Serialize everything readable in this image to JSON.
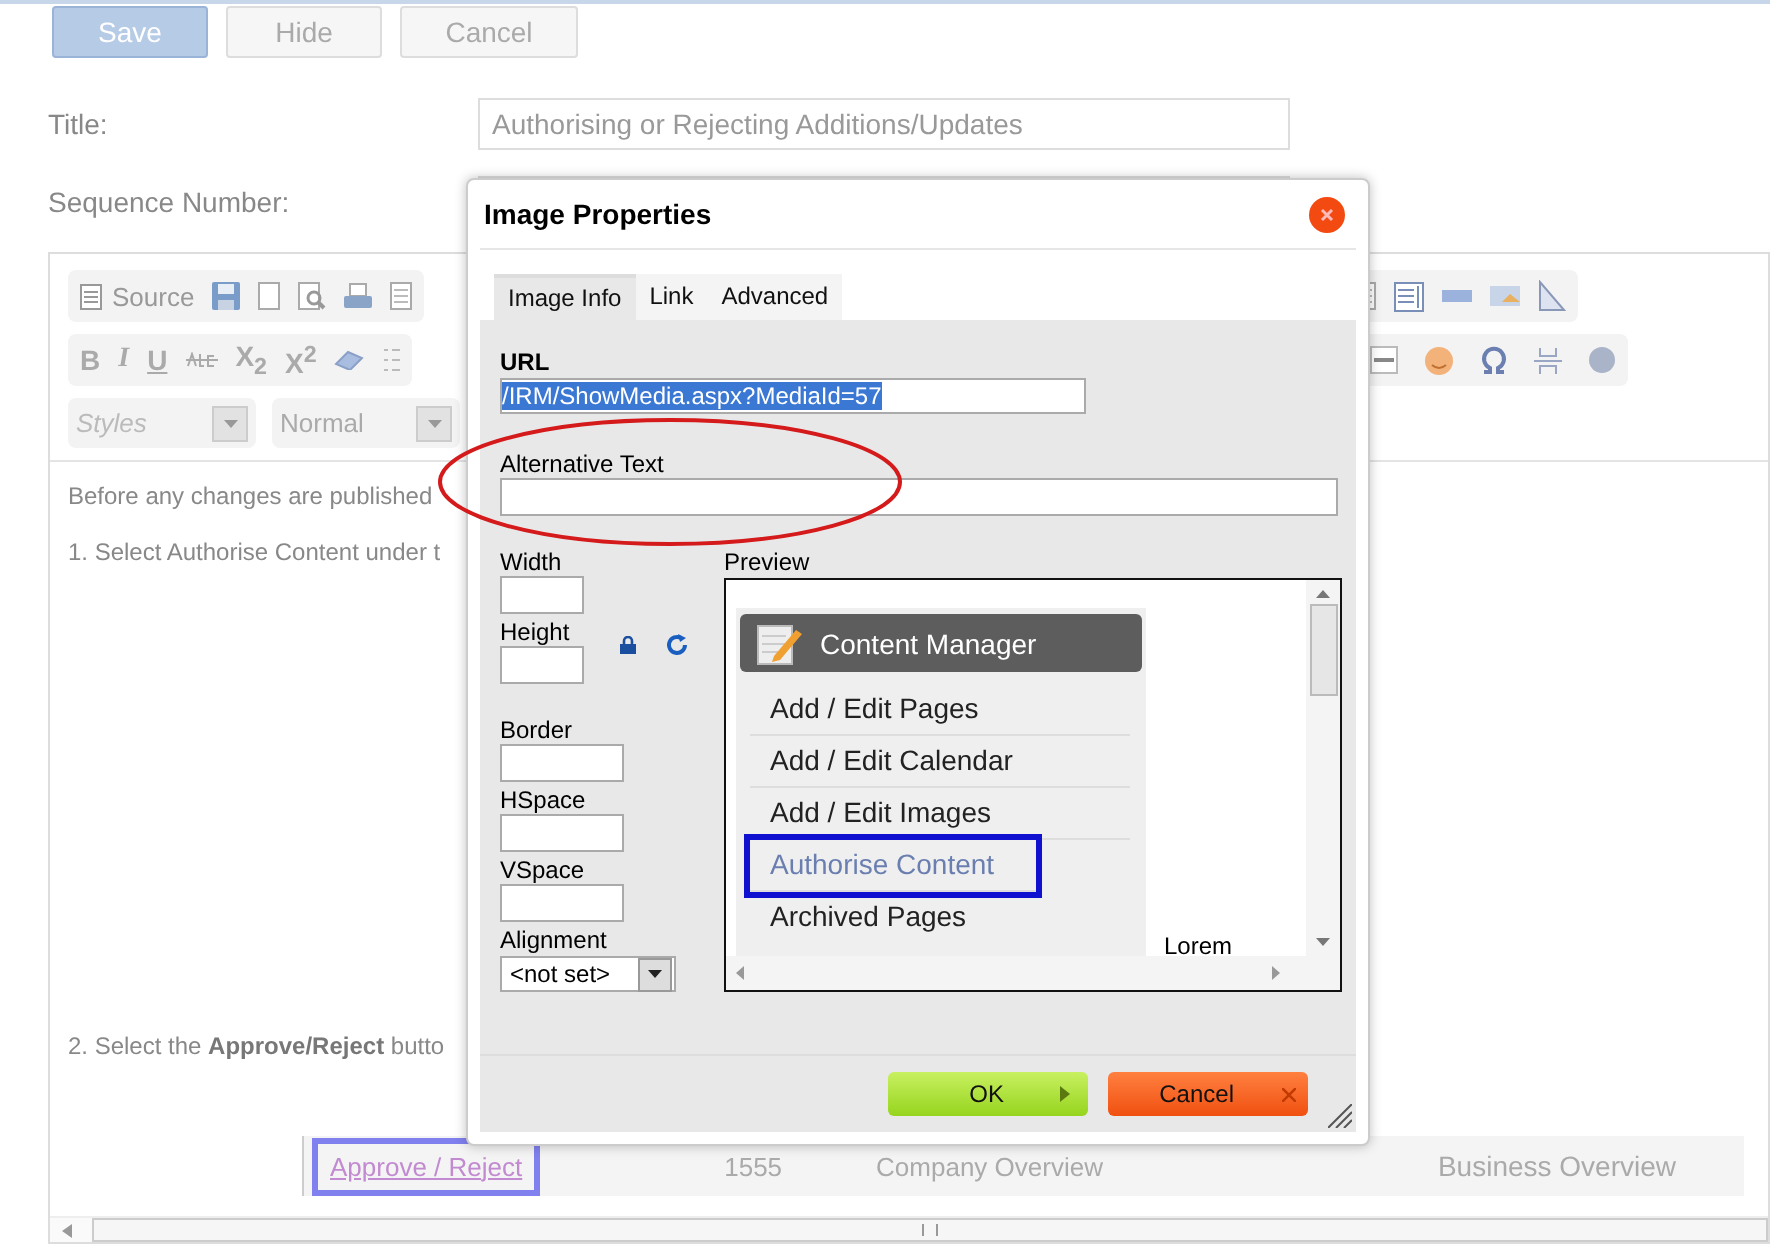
{
  "actions": [
    {
      "label": "Save",
      "kind": "primary"
    },
    {
      "label": "Hide",
      "kind": "plain"
    },
    {
      "label": "Cancel",
      "kind": "plain"
    }
  ],
  "form": [
    {
      "label": "Title:",
      "value": "Authorising or Rejecting Additions/Updates"
    },
    {
      "label": "Sequence Number:"
    }
  ],
  "editor": {
    "source_label": "Source",
    "format_buttons": [
      "B",
      "I",
      "U"
    ],
    "script_buttons": [
      "X$_{2}$",
      "X$^{2}$"
    ],
    "styles_placeholder": "Styles",
    "format_value": "Normal",
    "paragraphs": [
      "Before any changes are published",
      "1. Select Authorise Content under t"
    ],
    "step_two": "2. Select the **Approve/Reject** butto",
    "row": {
      "link": "Approve / Reject",
      "cells": [
        "1555",
        "Company Overview",
        "Business Overview"
      ]
    }
  },
  "dialog": {
    "title": "Image Properties",
    "tabs": [
      {
        "label": "Image Info",
        "selected": true
      },
      {
        "label": "Link",
        "selected": false
      },
      {
        "label": "Advanced",
        "selected": false
      }
    ],
    "url_label": "URL",
    "url_value": "/IRM/ShowMedia.aspx?MediaId=57",
    "alt_label": "Alternative Text",
    "size_fields": [
      {
        "label": "Width"
      },
      {
        "label": "Height"
      }
    ],
    "space_fields": [
      {
        "label": "Border"
      },
      {
        "label": "HSpace"
      },
      {
        "label": "VSpace"
      }
    ],
    "alignment_label": "Alignment",
    "alignment_value": "<not set>",
    "preview_label": "Preview",
    "preview": {
      "menu_title": "Content Manager",
      "items": [
        {
          "label": "Add / Edit Pages",
          "highlighted": false
        },
        {
          "label": "Add / Edit Calendar",
          "highlighted": false
        },
        {
          "label": "Add / Edit Images",
          "highlighted": false
        },
        {
          "label": "Authorise Content",
          "highlighted": true
        },
        {
          "label": "Archived Pages",
          "highlighted": false
        }
      ],
      "trailing_text": "Lorem"
    },
    "buttons": [
      {
        "label": "OK",
        "kind": "ok"
      },
      {
        "label": "Cancel",
        "kind": "cancel"
      }
    ]
  }
}
